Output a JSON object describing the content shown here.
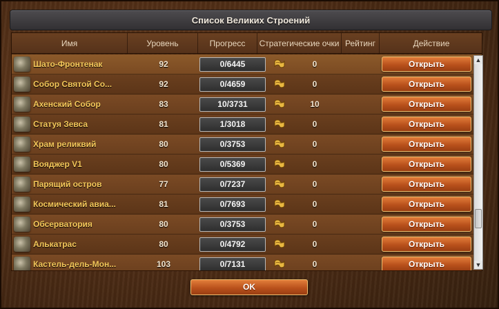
{
  "window": {
    "title": "Список Великих Строений"
  },
  "columns": {
    "name": "Имя",
    "level": "Уровень",
    "progress": "Прогресс",
    "strategic_points": "Стратегические очки",
    "rating": "Рейтинг",
    "action": "Действие"
  },
  "rows": [
    {
      "name": "Шато-Фронтенак",
      "level": "92",
      "progress": "0/6445",
      "points": "0",
      "action": "Открыть"
    },
    {
      "name": "Собор Святой Со...",
      "level": "92",
      "progress": "0/4659",
      "points": "0",
      "action": "Открыть"
    },
    {
      "name": "Ахенский Собор",
      "level": "83",
      "progress": "10/3731",
      "points": "10",
      "action": "Открыть"
    },
    {
      "name": "Статуя Зевса",
      "level": "81",
      "progress": "1/3018",
      "points": "0",
      "action": "Открыть"
    },
    {
      "name": "Храм реликвий",
      "level": "80",
      "progress": "0/3753",
      "points": "0",
      "action": "Открыть"
    },
    {
      "name": "Вояджер V1",
      "level": "80",
      "progress": "0/5369",
      "points": "0",
      "action": "Открыть"
    },
    {
      "name": "Парящий остров",
      "level": "77",
      "progress": "0/7237",
      "points": "0",
      "action": "Открыть"
    },
    {
      "name": "Космический авиа...",
      "level": "81",
      "progress": "0/7693",
      "points": "0",
      "action": "Открыть"
    },
    {
      "name": "Обсерватория",
      "level": "80",
      "progress": "0/3753",
      "points": "0",
      "action": "Открыть"
    },
    {
      "name": "Алькатрас",
      "level": "80",
      "progress": "0/4792",
      "points": "0",
      "action": "Открыть"
    },
    {
      "name": "Кастель-дель-Мон...",
      "level": "103",
      "progress": "0/7131",
      "points": "0",
      "action": "Открыть"
    }
  ],
  "footer": {
    "ok_label": "OK"
  },
  "icons": {
    "strategic_points": "forge-points-scroll-icon",
    "building": "building-thumbnail-icon"
  },
  "colors": {
    "button": "#c0561f",
    "name_text": "#f5c85a",
    "header_bg": "#5e381b"
  }
}
